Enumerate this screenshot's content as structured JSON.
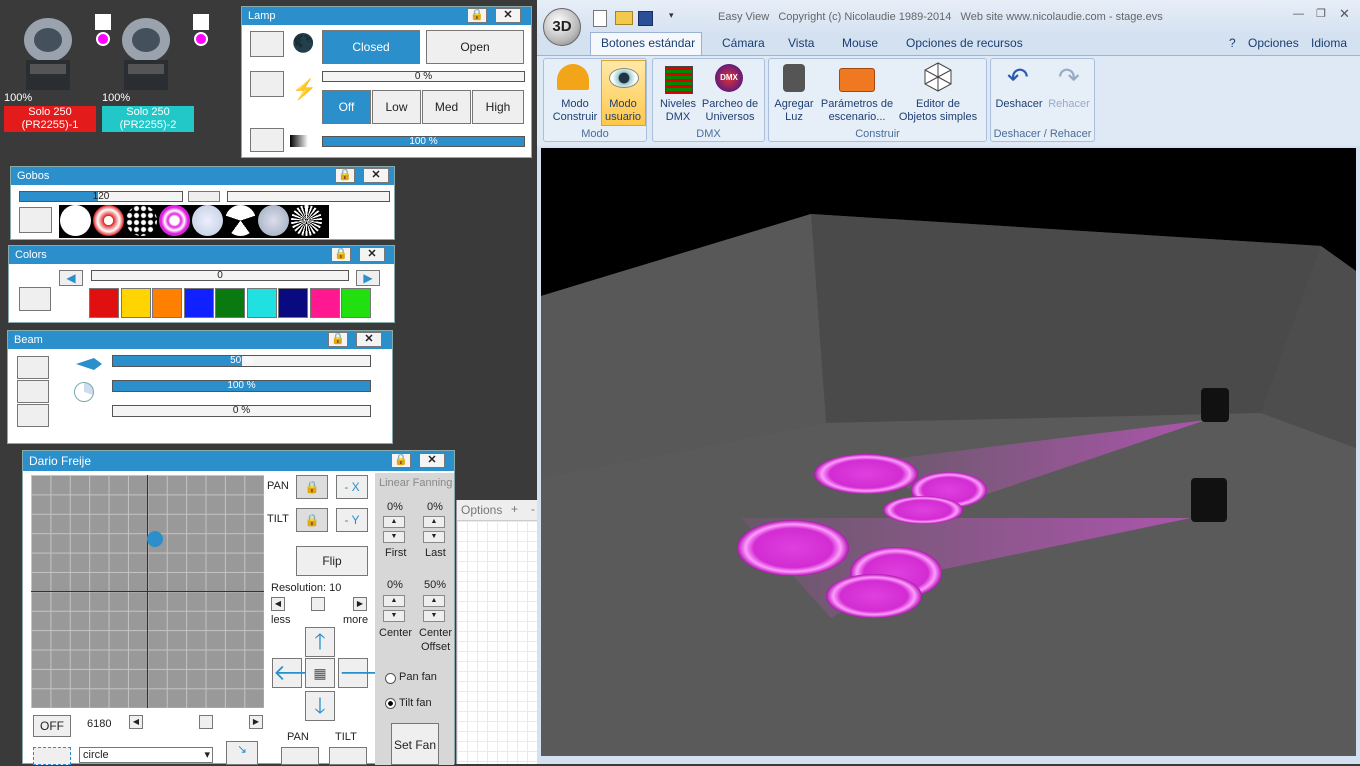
{
  "fixtures": [
    {
      "level": "100%",
      "name_line1": "Solo 250",
      "name_line2": "(PR2255)-1",
      "color": "#e31b1b"
    },
    {
      "level": "100%",
      "name_line1": "Solo 250",
      "name_line2": "(PR2255)-2",
      "color": "#22c7c7"
    }
  ],
  "lamp": {
    "title": "Lamp",
    "closed": "Closed",
    "open": "Open",
    "power_value": "0 %",
    "off": "Off",
    "low": "Low",
    "med": "Med",
    "high": "High",
    "dimmer_value": "100 %"
  },
  "gobos": {
    "title": "Gobos",
    "value": "120"
  },
  "colors": {
    "title": "Colors",
    "value": "0",
    "swatches": [
      "#e01010",
      "#ffd400",
      "#ff7f00",
      "#1020ff",
      "#0a7a10",
      "#20e0e0",
      "#0a0a80",
      "#ff1890",
      "#22e010"
    ]
  },
  "beam": {
    "title": "Beam",
    "focus": "50 %",
    "zoom": "100 %",
    "prism": "0 %"
  },
  "dario": {
    "title": "Dario Freije",
    "pan": "PAN",
    "tilt": "TILT",
    "minus_x": "- X",
    "minus_y": "- Y",
    "flip": "Flip",
    "resolution": "Resolution: 10",
    "less": "less",
    "more": "more",
    "off": "OFF",
    "speed": "6180",
    "shape": "circle",
    "pan_label": "PAN",
    "tilt_label": "TILT",
    "fanning_title": "Linear Fanning",
    "first_val": "0%",
    "last_val": "0%",
    "first": "First",
    "last": "Last",
    "center_val": "0%",
    "offset_val": "50%",
    "center": "Center",
    "center_offset_1": "Center",
    "center_offset_2": "Offset",
    "pan_fan": "Pan fan",
    "tilt_fan": "Tilt fan",
    "set_fan": "Set Fan"
  },
  "options_panel": {
    "label": "Options",
    "plus": "+",
    "minus": "-"
  },
  "easyview": {
    "title": "Easy View   Copyright (c) Nicolaudie 1989-2014   Web site www.nicolaudie.com - stage.evs",
    "logo": "3D",
    "tabs": [
      "Botones estándar",
      "Cámara",
      "Vista",
      "Mouse",
      "Opciones de recursos"
    ],
    "right_menu": [
      "?",
      "Opciones",
      "Idioma"
    ],
    "buttons": [
      {
        "l1": "Modo",
        "l2": "Construir"
      },
      {
        "l1": "Modo",
        "l2": "usuario"
      },
      {
        "l1": "Niveles",
        "l2": "DMX"
      },
      {
        "l1": "Parcheo de",
        "l2": "Universos"
      },
      {
        "l1": "Agregar",
        "l2": "Luz"
      },
      {
        "l1": "Parámetros de",
        "l2": "escenario..."
      },
      {
        "l1": "Editor de",
        "l2": "Objetos simples"
      },
      {
        "l1": "Deshacer",
        "l2": ""
      },
      {
        "l1": "Rehacer",
        "l2": ""
      }
    ],
    "groups": [
      "Modo",
      "DMX",
      "Construir",
      "Deshacer / Rehacer"
    ],
    "icon_dmx_text": "DMX"
  },
  "colors_meta": {
    "accent": "#2b8fcb",
    "stage_bg": "#000000",
    "beam": "#e040e0"
  }
}
